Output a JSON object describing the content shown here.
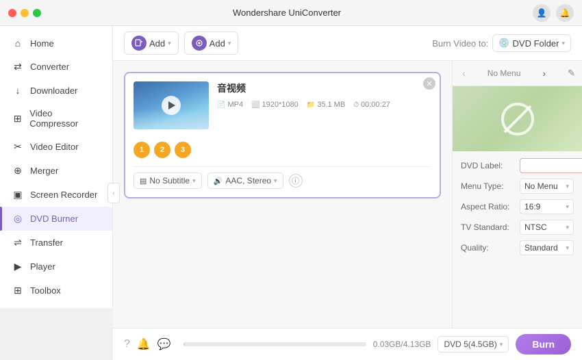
{
  "app": {
    "title": "Wondershare UniConverter"
  },
  "titlebar": {
    "dots": [
      "red",
      "yellow",
      "green"
    ]
  },
  "sidebar": {
    "items": [
      {
        "id": "home",
        "label": "Home",
        "icon": "⌂",
        "active": false
      },
      {
        "id": "converter",
        "label": "Converter",
        "icon": "⇄",
        "active": false
      },
      {
        "id": "downloader",
        "label": "Downloader",
        "icon": "↓",
        "active": false
      },
      {
        "id": "video-compressor",
        "label": "Video Compressor",
        "icon": "⊞",
        "active": false
      },
      {
        "id": "video-editor",
        "label": "Video Editor",
        "icon": "✂",
        "active": false
      },
      {
        "id": "merger",
        "label": "Merger",
        "icon": "⊕",
        "active": false
      },
      {
        "id": "screen-recorder",
        "label": "Screen Recorder",
        "icon": "▣",
        "active": false
      },
      {
        "id": "dvd-burner",
        "label": "DVD Burner",
        "icon": "◎",
        "active": true
      },
      {
        "id": "transfer",
        "label": "Transfer",
        "icon": "⇌",
        "active": false
      },
      {
        "id": "player",
        "label": "Player",
        "icon": "▶",
        "active": false
      },
      {
        "id": "toolbox",
        "label": "Toolbox",
        "icon": "⊞",
        "active": false
      }
    ]
  },
  "toolbar": {
    "add_video_label": "Add",
    "add_chapter_label": "Add",
    "burn_to_label": "Burn Video to:",
    "burn_target": "DVD Folder"
  },
  "video": {
    "title": "音视频",
    "format": "MP4",
    "resolution": "1920*1080",
    "size": "35.1 MB",
    "duration": "00:00:27",
    "subtitle_label": "No Subtitle",
    "audio_label": "AAC, Stereo",
    "action_btns": [
      {
        "num": "1",
        "icon": "✂"
      },
      {
        "num": "2",
        "icon": "⬜"
      },
      {
        "num": "3",
        "icon": "≡"
      }
    ]
  },
  "dvd_panel": {
    "nav_label": "No Menu",
    "label_field": "DVD Label:",
    "label_value": "",
    "menu_type_label": "Menu Type:",
    "menu_type_value": "No Menu",
    "aspect_ratio_label": "Aspect Ratio:",
    "aspect_ratio_value": "16:9",
    "tv_standard_label": "TV Standard:",
    "tv_standard_value": "NTSC",
    "quality_label": "Quality:",
    "quality_value": "Standard"
  },
  "bottom": {
    "progress_text": "0.03GB/4.13GB",
    "dvd_type": "DVD 5(4.5GB)",
    "burn_label": "Burn"
  }
}
